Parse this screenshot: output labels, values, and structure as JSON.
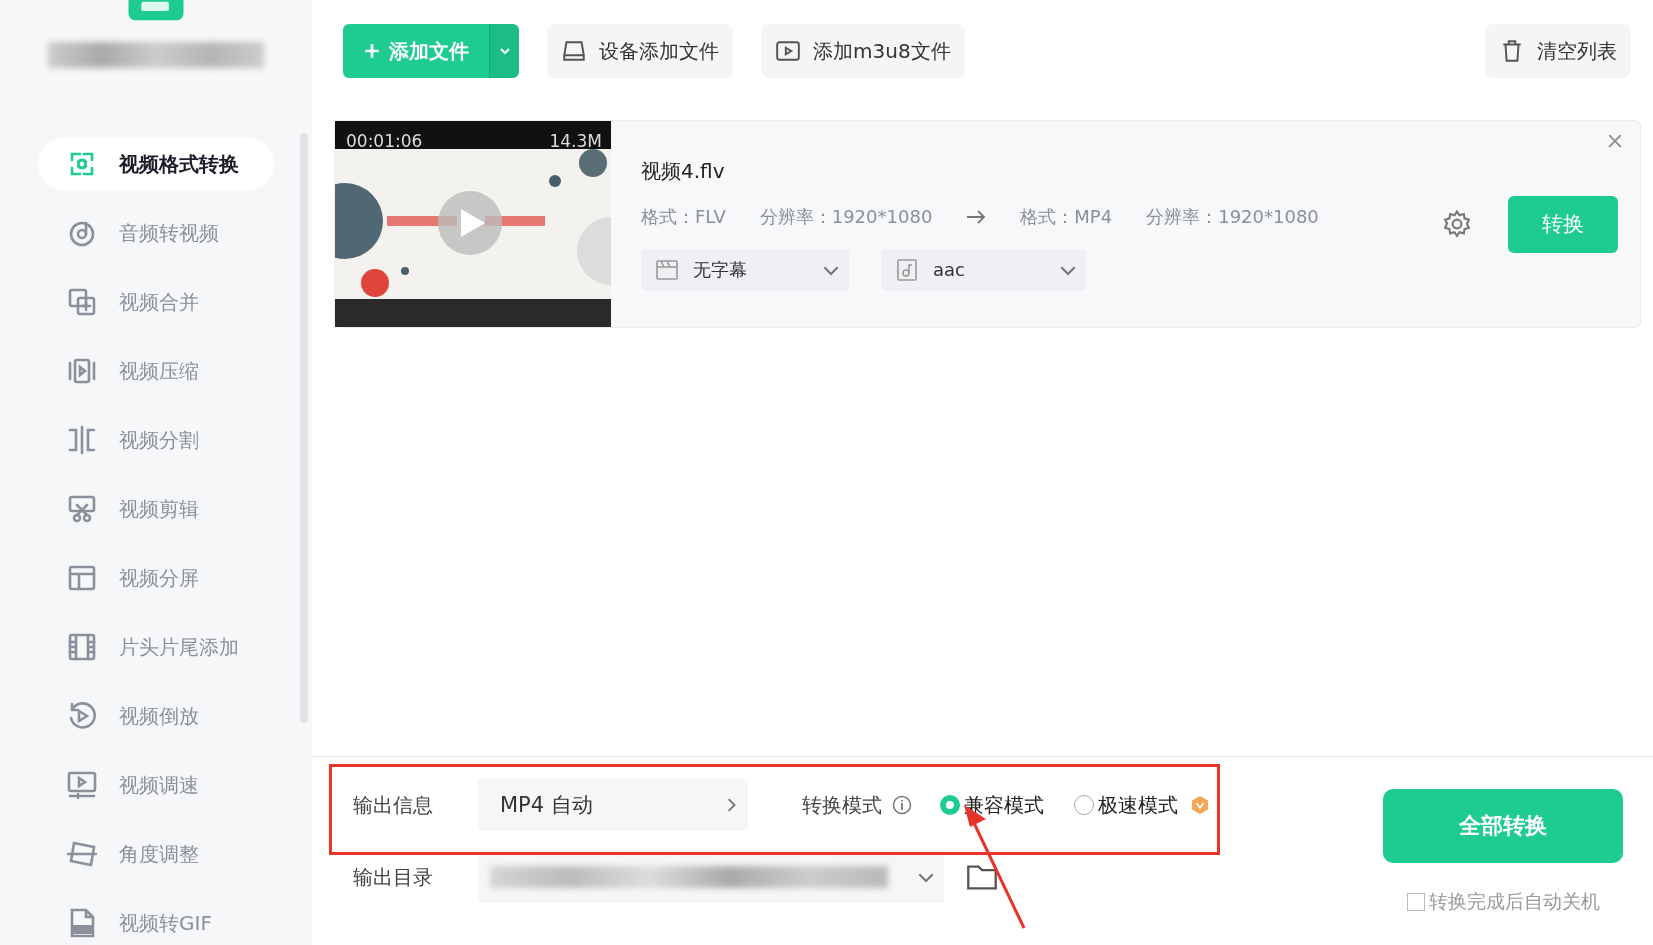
{
  "toolbar": {
    "add_file": "添加文件",
    "device_add": "设备添加文件",
    "add_m3u8": "添加m3u8文件",
    "clear_list": "清空列表"
  },
  "sidebar": {
    "items": [
      {
        "label": "视频格式转换",
        "selected": true
      },
      {
        "label": "音频转视频",
        "selected": false
      },
      {
        "label": "视频合并",
        "selected": false
      },
      {
        "label": "视频压缩",
        "selected": false
      },
      {
        "label": "视频分割",
        "selected": false
      },
      {
        "label": "视频剪辑",
        "selected": false
      },
      {
        "label": "视频分屏",
        "selected": false
      },
      {
        "label": "片头片尾添加",
        "selected": false
      },
      {
        "label": "视频倒放",
        "selected": false
      },
      {
        "label": "视频调速",
        "selected": false
      },
      {
        "label": "角度调整",
        "selected": false
      },
      {
        "label": "视频转GIF",
        "selected": false
      }
    ]
  },
  "files": [
    {
      "duration": "00:01:06",
      "size": "14.3M",
      "name": "视频4.flv",
      "source_format": "格式：FLV",
      "source_resolution": "分辨率：1920*1080",
      "target_format": "格式：MP4",
      "target_resolution": "分辨率：1920*1080",
      "subtitle": "无字幕",
      "audio": "aac",
      "convert": "转换"
    }
  ],
  "output": {
    "info_label": "输出信息",
    "format": "MP4 自动",
    "mode_label": "转换模式",
    "modes": [
      {
        "label": "兼容模式",
        "selected": true
      },
      {
        "label": "极速模式",
        "selected": false
      }
    ],
    "dir_label": "输出目录",
    "convert_all": "全部转换",
    "auto_shutdown": {
      "label": "转换完成后自动关机",
      "checked": false
    }
  }
}
